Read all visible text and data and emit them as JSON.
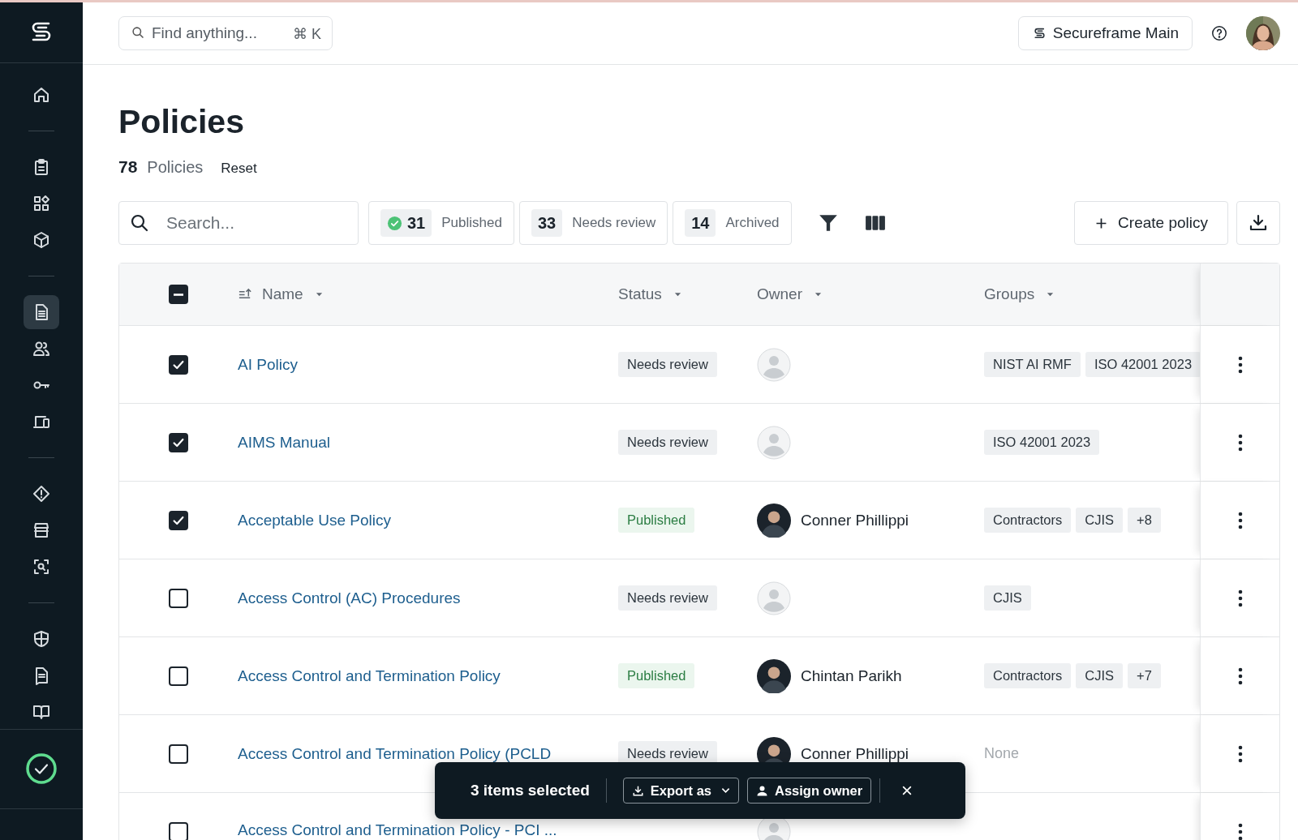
{
  "sidebar": {
    "groups": [
      [
        {
          "selected": false
        }
      ],
      [
        {
          "selected": false
        },
        {
          "selected": false
        },
        {
          "selected": false
        }
      ],
      [
        {
          "selected": true
        },
        {
          "selected": false
        },
        {
          "selected": false
        },
        {
          "selected": false
        }
      ],
      [
        {
          "selected": false
        },
        {
          "selected": false
        },
        {
          "selected": false
        }
      ],
      [
        {
          "selected": false
        },
        {
          "selected": false
        },
        {
          "selected": false
        }
      ]
    ],
    "status": {
      "ok": true
    }
  },
  "topbar": {
    "search": {
      "placeholder": "Find anything...",
      "shortcut": "⌘ K"
    },
    "workspace": "Secureframe Main"
  },
  "page": {
    "title": "Policies",
    "count": "78",
    "count_label": "Policies",
    "reset": "Reset"
  },
  "toolbar": {
    "search": {
      "placeholder": "Search..."
    },
    "filters": [
      {
        "kind": "published",
        "count": "31",
        "label": "Published",
        "selected": false
      },
      {
        "kind": "review",
        "count": "33",
        "label": "Needs review",
        "selected": false
      },
      {
        "kind": "archived",
        "count": "14",
        "label": "Archived",
        "selected": false
      }
    ],
    "create": "Create policy"
  },
  "table": {
    "select_all_partial": true,
    "columns": [
      {
        "label": "Name",
        "sorted": true
      },
      {
        "label": "Status",
        "sorted": false
      },
      {
        "label": "Owner",
        "sorted": false
      },
      {
        "label": "Groups",
        "sorted": false
      }
    ],
    "rows": [
      {
        "checked": true,
        "name": "AI Policy",
        "status": {
          "kind": "review",
          "label": "Needs review"
        },
        "owner": null,
        "groups": [
          {
            "kind": "tag",
            "label": "NIST AI RMF"
          },
          {
            "kind": "tag",
            "label": "ISO 42001 2023"
          }
        ]
      },
      {
        "checked": true,
        "name": "AIMS Manual",
        "status": {
          "kind": "review",
          "label": "Needs review"
        },
        "owner": null,
        "groups": [
          {
            "kind": "tag",
            "label": "ISO 42001 2023"
          }
        ]
      },
      {
        "checked": true,
        "name": "Acceptable Use Policy",
        "status": {
          "kind": "published",
          "label": "Published"
        },
        "owner": {
          "name": "Conner Phillippi"
        },
        "groups": [
          {
            "kind": "tag",
            "label": "Contractors"
          },
          {
            "kind": "tag",
            "label": "CJIS"
          },
          {
            "kind": "tag",
            "label": "+8"
          }
        ]
      },
      {
        "checked": false,
        "name": "Access Control (AC) Procedures",
        "status": {
          "kind": "review",
          "label": "Needs review"
        },
        "owner": null,
        "groups": [
          {
            "kind": "tag",
            "label": "CJIS"
          }
        ]
      },
      {
        "checked": false,
        "name": "Access Control and Termination Policy",
        "status": {
          "kind": "published",
          "label": "Published"
        },
        "owner": {
          "name": "Chintan Parikh"
        },
        "groups": [
          {
            "kind": "tag",
            "label": "Contractors"
          },
          {
            "kind": "tag",
            "label": "CJIS"
          },
          {
            "kind": "tag",
            "label": "+7"
          }
        ]
      },
      {
        "checked": false,
        "name": "Access Control and Termination Policy (PCLD",
        "status": {
          "kind": "review",
          "label": "Needs review"
        },
        "owner": {
          "name": "Conner Phillippi"
        },
        "groups": [
          {
            "kind": "empty",
            "label": "None"
          }
        ]
      },
      {
        "checked": false,
        "name": "Access Control and Termination Policy - PCI ...",
        "owner": null,
        "groups": []
      }
    ]
  },
  "selection_bar": {
    "label": "3 items selected",
    "export": "Export as",
    "assign": "Assign owner"
  }
}
